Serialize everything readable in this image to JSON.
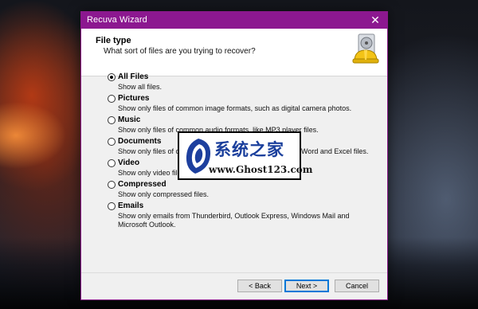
{
  "window": {
    "title": "Recuva Wizard",
    "close_glyph": "✕"
  },
  "header": {
    "title": "File type",
    "subtitle": "What sort of files are you trying to recover?",
    "logo_icon": "recuva-hardhat-drive-icon"
  },
  "options": [
    {
      "name": "All Files",
      "description": "Show all files.",
      "checked": true
    },
    {
      "name": "Pictures",
      "description": "Show only files of common image formats, such as digital camera photos.",
      "checked": false
    },
    {
      "name": "Music",
      "description": "Show only files of common audio formats, like MP3 player files.",
      "checked": false
    },
    {
      "name": "Documents",
      "description": "Show only files of co",
      "description_tail": "Word and Excel files.",
      "checked": false
    },
    {
      "name": "Video",
      "description": "Show only video files",
      "checked": false
    },
    {
      "name": "Compressed",
      "description": "Show only compressed files.",
      "checked": false
    },
    {
      "name": "Emails",
      "description": "Show only emails from Thunderbird, Outlook Express, Windows Mail and Microsoft Outlook.",
      "checked": false
    }
  ],
  "watermark": {
    "chinese": "系统之家",
    "url": "www.Ghost123.com"
  },
  "buttons": {
    "back": "< Back",
    "next": "Next >",
    "cancel": "Cancel"
  },
  "colors": {
    "title_bar": "#8c1890",
    "watermark_text": "#1a3f9c"
  }
}
